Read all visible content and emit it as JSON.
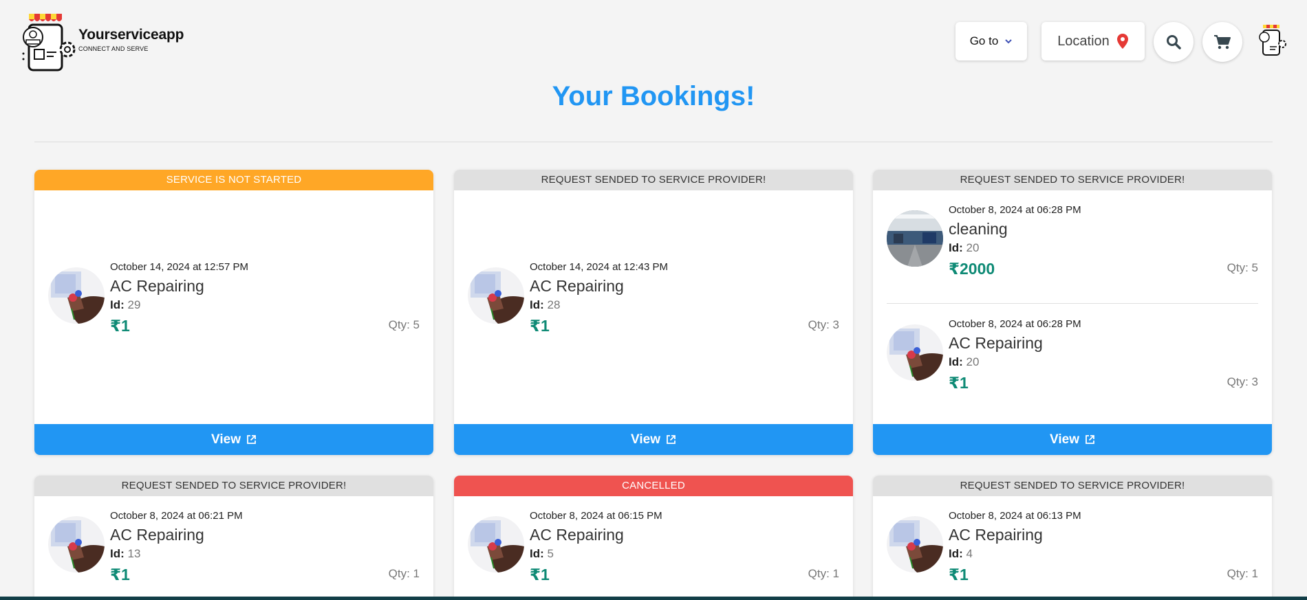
{
  "brand": {
    "name": "Yourserviceapp",
    "tagline": "CONNECT AND SERVE"
  },
  "nav": {
    "goto_label": "Go to",
    "location_label": "Location"
  },
  "page_title": "Your Bookings!",
  "view_label": "View",
  "bookings": [
    {
      "status": "SERVICE IS NOT STARTED",
      "status_color": "#ffa726",
      "items": [
        {
          "date": "October 14, 2024 at 12:57 PM",
          "service": "AC Repairing",
          "id_label": "Id:",
          "id": "29",
          "price": "₹1",
          "qty": "Qty: 5"
        }
      ]
    },
    {
      "status": "REQUEST SENDED TO SERVICE PROVIDER!",
      "status_color": "#e0e0e0",
      "items": [
        {
          "date": "October 14, 2024 at 12:43 PM",
          "service": "AC Repairing",
          "id_label": "Id:",
          "id": "28",
          "price": "₹1",
          "qty": "Qty: 3"
        }
      ]
    },
    {
      "status": "REQUEST SENDED TO SERVICE PROVIDER!",
      "status_color": "#e0e0e0",
      "items": [
        {
          "date": "October 8, 2024 at 06:28 PM",
          "service": "cleaning",
          "id_label": "Id:",
          "id": "20",
          "price": "₹2000",
          "qty": "Qty: 5"
        },
        {
          "date": "October 8, 2024 at 06:28 PM",
          "service": "AC Repairing",
          "id_label": "Id:",
          "id": "20",
          "price": "₹1",
          "qty": "Qty: 3"
        }
      ]
    },
    {
      "status": "REQUEST SENDED TO SERVICE PROVIDER!",
      "status_color": "#e0e0e0",
      "items": [
        {
          "date": "October 8, 2024 at 06:21 PM",
          "service": "AC Repairing",
          "id_label": "Id:",
          "id": "13",
          "price": "₹1",
          "qty": "Qty: 1"
        }
      ]
    },
    {
      "status": "CANCELLED",
      "status_color": "#ef5350",
      "items": [
        {
          "date": "October 8, 2024 at 06:15 PM",
          "service": "AC Repairing",
          "id_label": "Id:",
          "id": "5",
          "price": "₹1",
          "qty": "Qty: 1"
        }
      ]
    },
    {
      "status": "REQUEST SENDED TO SERVICE PROVIDER!",
      "status_color": "#e0e0e0",
      "items": [
        {
          "date": "October 8, 2024 at 06:13 PM",
          "service": "AC Repairing",
          "id_label": "Id:",
          "id": "4",
          "price": "₹1",
          "qty": "Qty: 1"
        }
      ]
    }
  ]
}
